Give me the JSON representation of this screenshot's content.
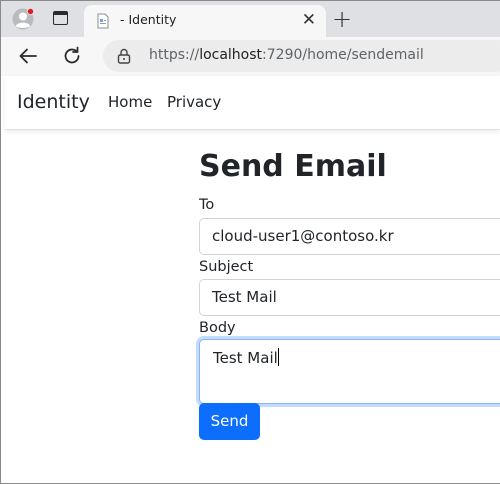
{
  "browser": {
    "tab_title": "- Identity",
    "url_prefix": "https://",
    "url_host": "localhost",
    "url_rest": ":7290/home/sendemail"
  },
  "navbar": {
    "brand": "Identity",
    "links": [
      "Home",
      "Privacy"
    ]
  },
  "form": {
    "title": "Send Email",
    "to_label": "To",
    "to_value": "cloud-user1@contoso.kr",
    "subject_label": "Subject",
    "subject_value": "Test Mail",
    "body_label": "Body",
    "body_value": "Test Mail",
    "submit_label": "Send"
  },
  "colors": {
    "primary": "#0d6efd",
    "focus_border": "#86b7fe"
  }
}
